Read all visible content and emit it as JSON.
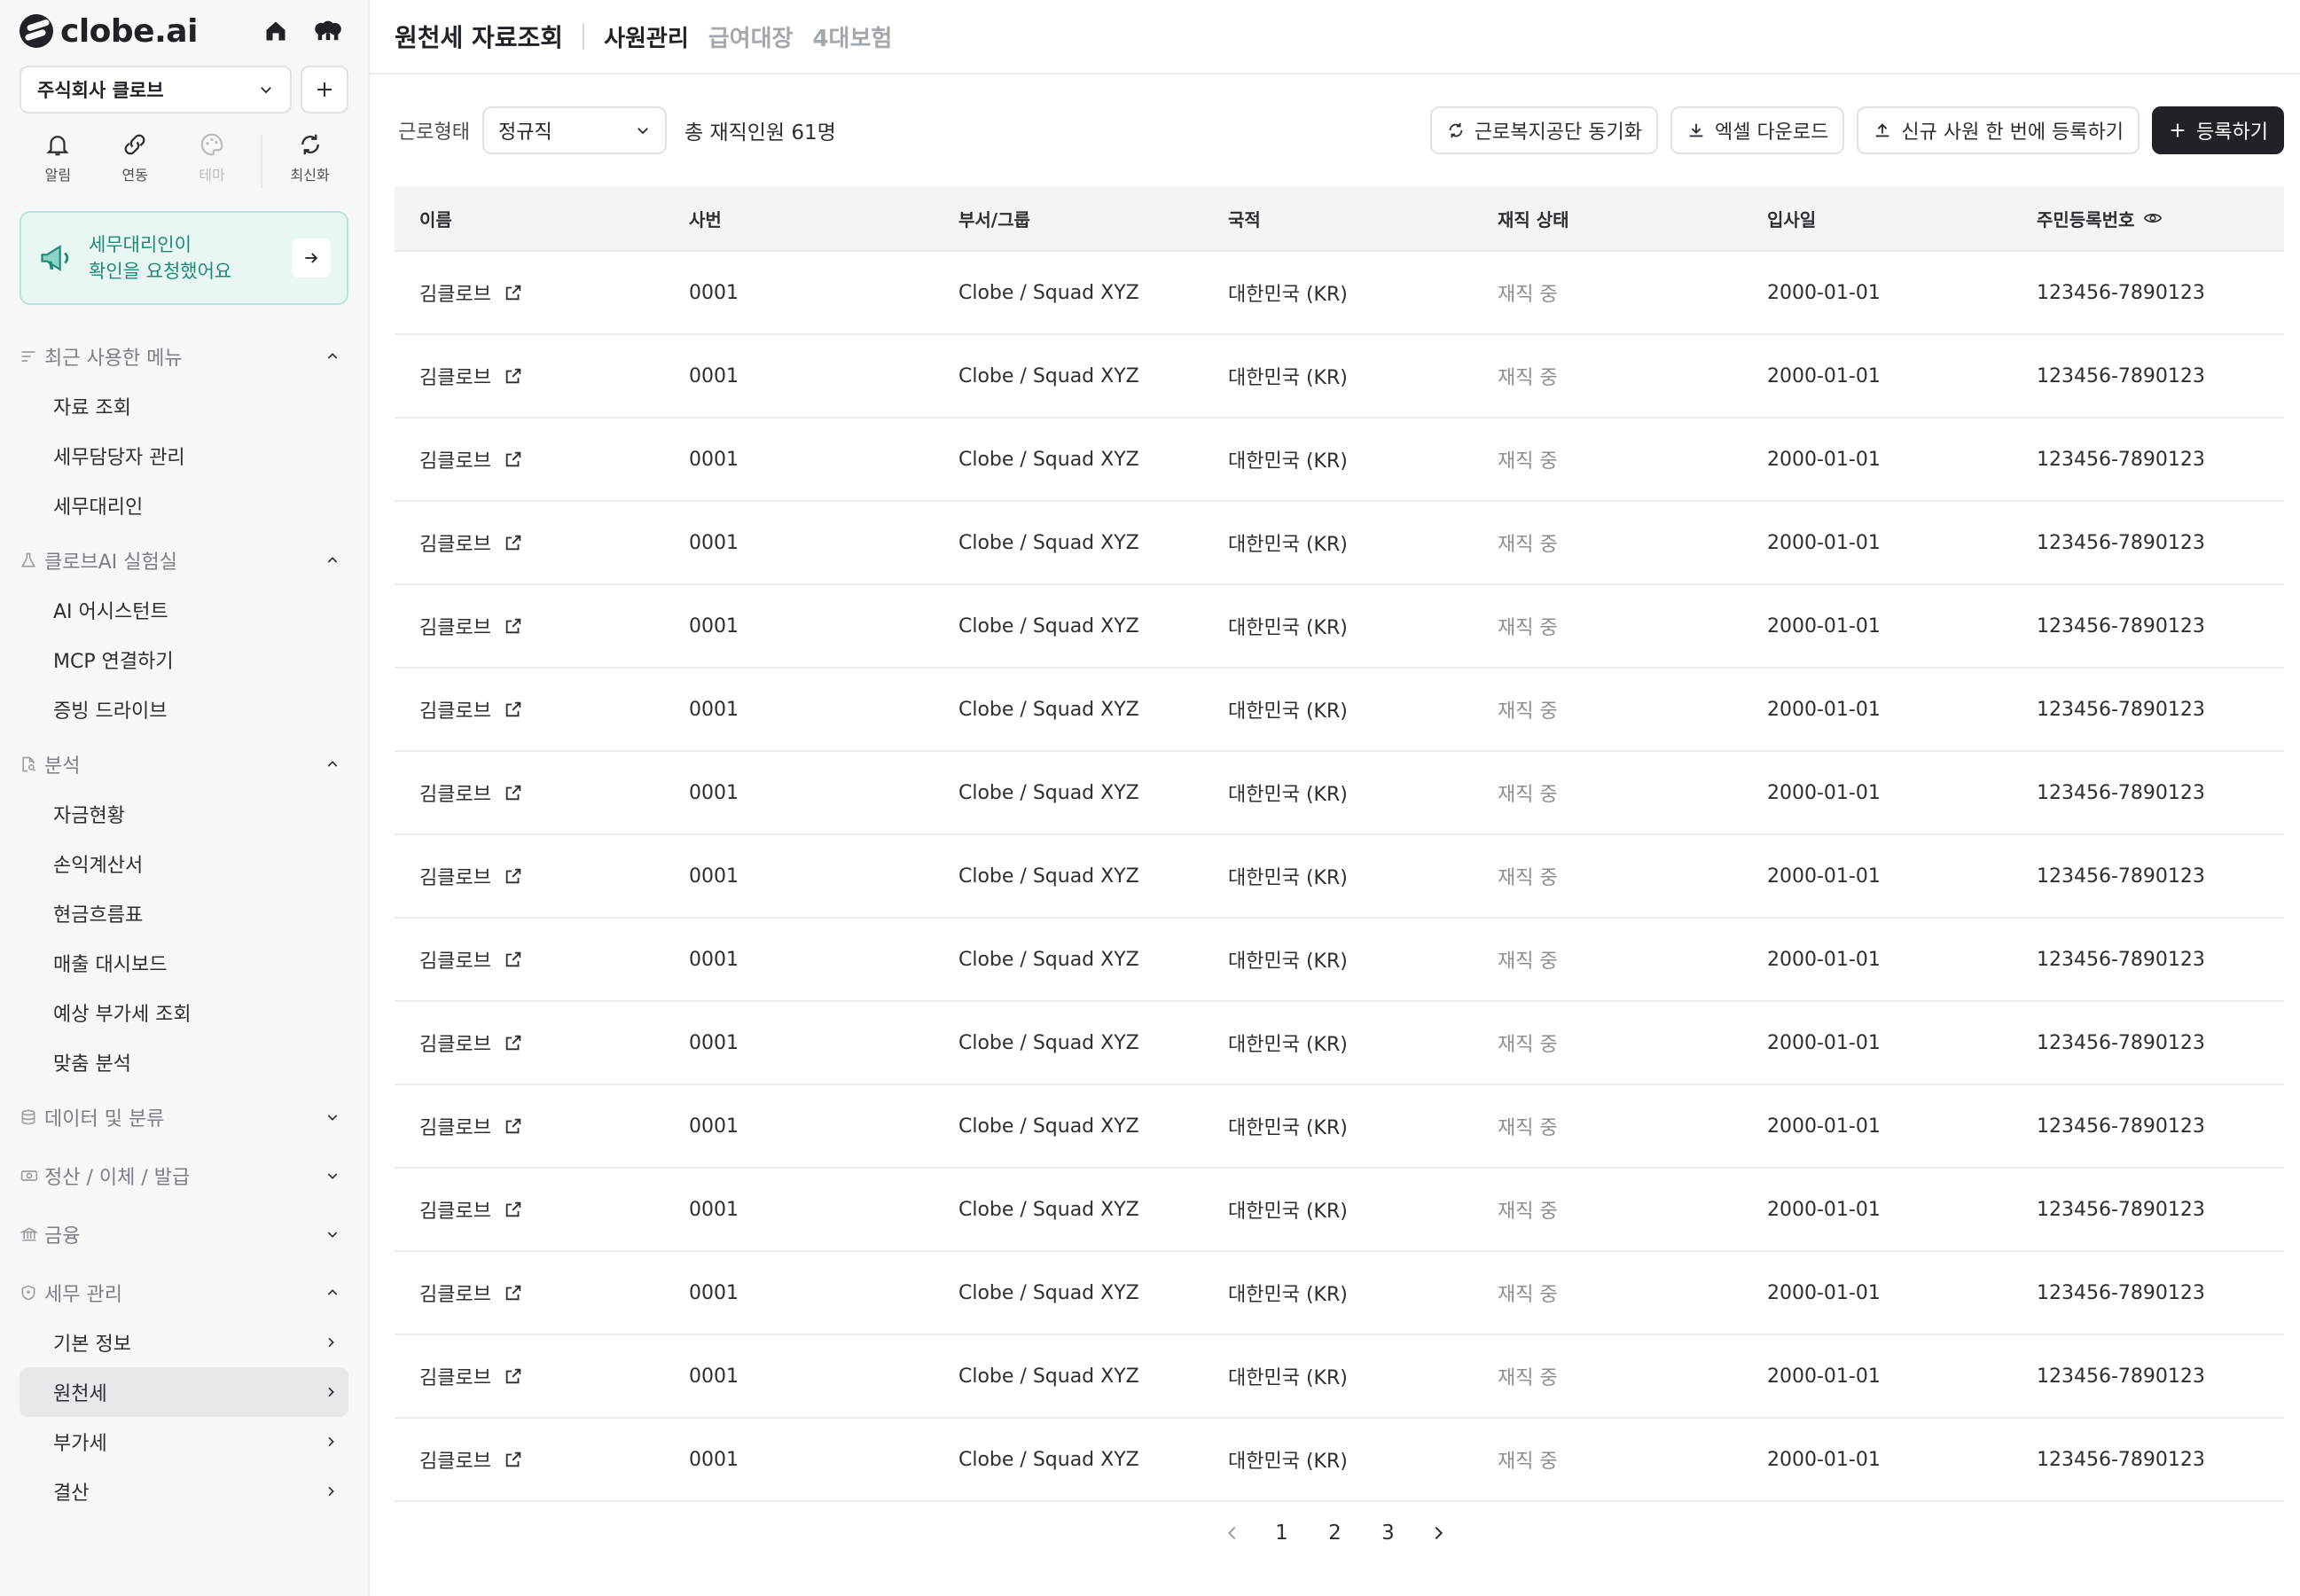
{
  "brand": {
    "name": "clobe.ai"
  },
  "company": {
    "name": "주식회사 클로브"
  },
  "quick_actions": [
    {
      "label": "알림",
      "icon": "bell-icon",
      "disabled": false
    },
    {
      "label": "연동",
      "icon": "link-icon",
      "disabled": false
    },
    {
      "label": "테마",
      "icon": "palette-icon",
      "disabled": true
    },
    {
      "label": "최신화",
      "icon": "refresh-icon",
      "disabled": false
    }
  ],
  "notice": {
    "line1": "세무대리인이",
    "line2": "확인을 요청했어요"
  },
  "menu": {
    "recent": {
      "title": "최근 사용한 메뉴",
      "items": [
        "자료 조회",
        "세무담당자 관리",
        "세무대리인"
      ]
    },
    "lab": {
      "title": "클로브AI 실험실",
      "items": [
        "AI 어시스턴트",
        "MCP 연결하기",
        "증빙 드라이브"
      ]
    },
    "analysis": {
      "title": "분석",
      "items": [
        "자금현황",
        "손익계산서",
        "현금흐름표",
        "매출 대시보드",
        "예상 부가세 조회",
        "맞춤 분석"
      ]
    },
    "data": {
      "title": "데이터 및 분류"
    },
    "settle": {
      "title": "정산 / 이체 / 발급"
    },
    "finance": {
      "title": "금융"
    },
    "tax": {
      "title": "세무 관리",
      "items": [
        "기본 정보",
        "원천세",
        "부가세",
        "결산"
      ]
    }
  },
  "header": {
    "title": "원천세 자료조회",
    "tabs": [
      "사원관리",
      "급여대장",
      "4대보험"
    ]
  },
  "toolbar": {
    "filter_label": "근로형태",
    "filter_value": "정규직",
    "total": "총 재직인원 61명",
    "sync_label": "근로복지공단 동기화",
    "excel_label": "엑셀 다운로드",
    "bulk_label": "신규 사원 한 번에 등록하기",
    "register_label": "등록하기"
  },
  "table": {
    "columns": [
      "이름",
      "사번",
      "부서/그룹",
      "국적",
      "재직 상태",
      "입사일",
      "주민등록번호"
    ],
    "rows": [
      [
        "김클로브",
        "0001",
        "Clobe / Squad XYZ",
        "대한민국 (KR)",
        "재직 중",
        "2000-01-01",
        "123456-7890123"
      ],
      [
        "김클로브",
        "0001",
        "Clobe / Squad XYZ",
        "대한민국 (KR)",
        "재직 중",
        "2000-01-01",
        "123456-7890123"
      ],
      [
        "김클로브",
        "0001",
        "Clobe / Squad XYZ",
        "대한민국 (KR)",
        "재직 중",
        "2000-01-01",
        "123456-7890123"
      ],
      [
        "김클로브",
        "0001",
        "Clobe / Squad XYZ",
        "대한민국 (KR)",
        "재직 중",
        "2000-01-01",
        "123456-7890123"
      ],
      [
        "김클로브",
        "0001",
        "Clobe / Squad XYZ",
        "대한민국 (KR)",
        "재직 중",
        "2000-01-01",
        "123456-7890123"
      ],
      [
        "김클로브",
        "0001",
        "Clobe / Squad XYZ",
        "대한민국 (KR)",
        "재직 중",
        "2000-01-01",
        "123456-7890123"
      ],
      [
        "김클로브",
        "0001",
        "Clobe / Squad XYZ",
        "대한민국 (KR)",
        "재직 중",
        "2000-01-01",
        "123456-7890123"
      ],
      [
        "김클로브",
        "0001",
        "Clobe / Squad XYZ",
        "대한민국 (KR)",
        "재직 중",
        "2000-01-01",
        "123456-7890123"
      ],
      [
        "김클로브",
        "0001",
        "Clobe / Squad XYZ",
        "대한민국 (KR)",
        "재직 중",
        "2000-01-01",
        "123456-7890123"
      ],
      [
        "김클로브",
        "0001",
        "Clobe / Squad XYZ",
        "대한민국 (KR)",
        "재직 중",
        "2000-01-01",
        "123456-7890123"
      ],
      [
        "김클로브",
        "0001",
        "Clobe / Squad XYZ",
        "대한민국 (KR)",
        "재직 중",
        "2000-01-01",
        "123456-7890123"
      ],
      [
        "김클로브",
        "0001",
        "Clobe / Squad XYZ",
        "대한민국 (KR)",
        "재직 중",
        "2000-01-01",
        "123456-7890123"
      ],
      [
        "김클로브",
        "0001",
        "Clobe / Squad XYZ",
        "대한민국 (KR)",
        "재직 중",
        "2000-01-01",
        "123456-7890123"
      ],
      [
        "김클로브",
        "0001",
        "Clobe / Squad XYZ",
        "대한민국 (KR)",
        "재직 중",
        "2000-01-01",
        "123456-7890123"
      ],
      [
        "김클로브",
        "0001",
        "Clobe / Squad XYZ",
        "대한민국 (KR)",
        "재직 중",
        "2000-01-01",
        "123456-7890123"
      ]
    ]
  },
  "pagination": {
    "pages": [
      "1",
      "2",
      "3"
    ],
    "current": "1"
  },
  "colors": {
    "accent_teal": "#1f8a78",
    "primary_dark": "#1f2328",
    "notice_bg": "#e9f7f4"
  }
}
